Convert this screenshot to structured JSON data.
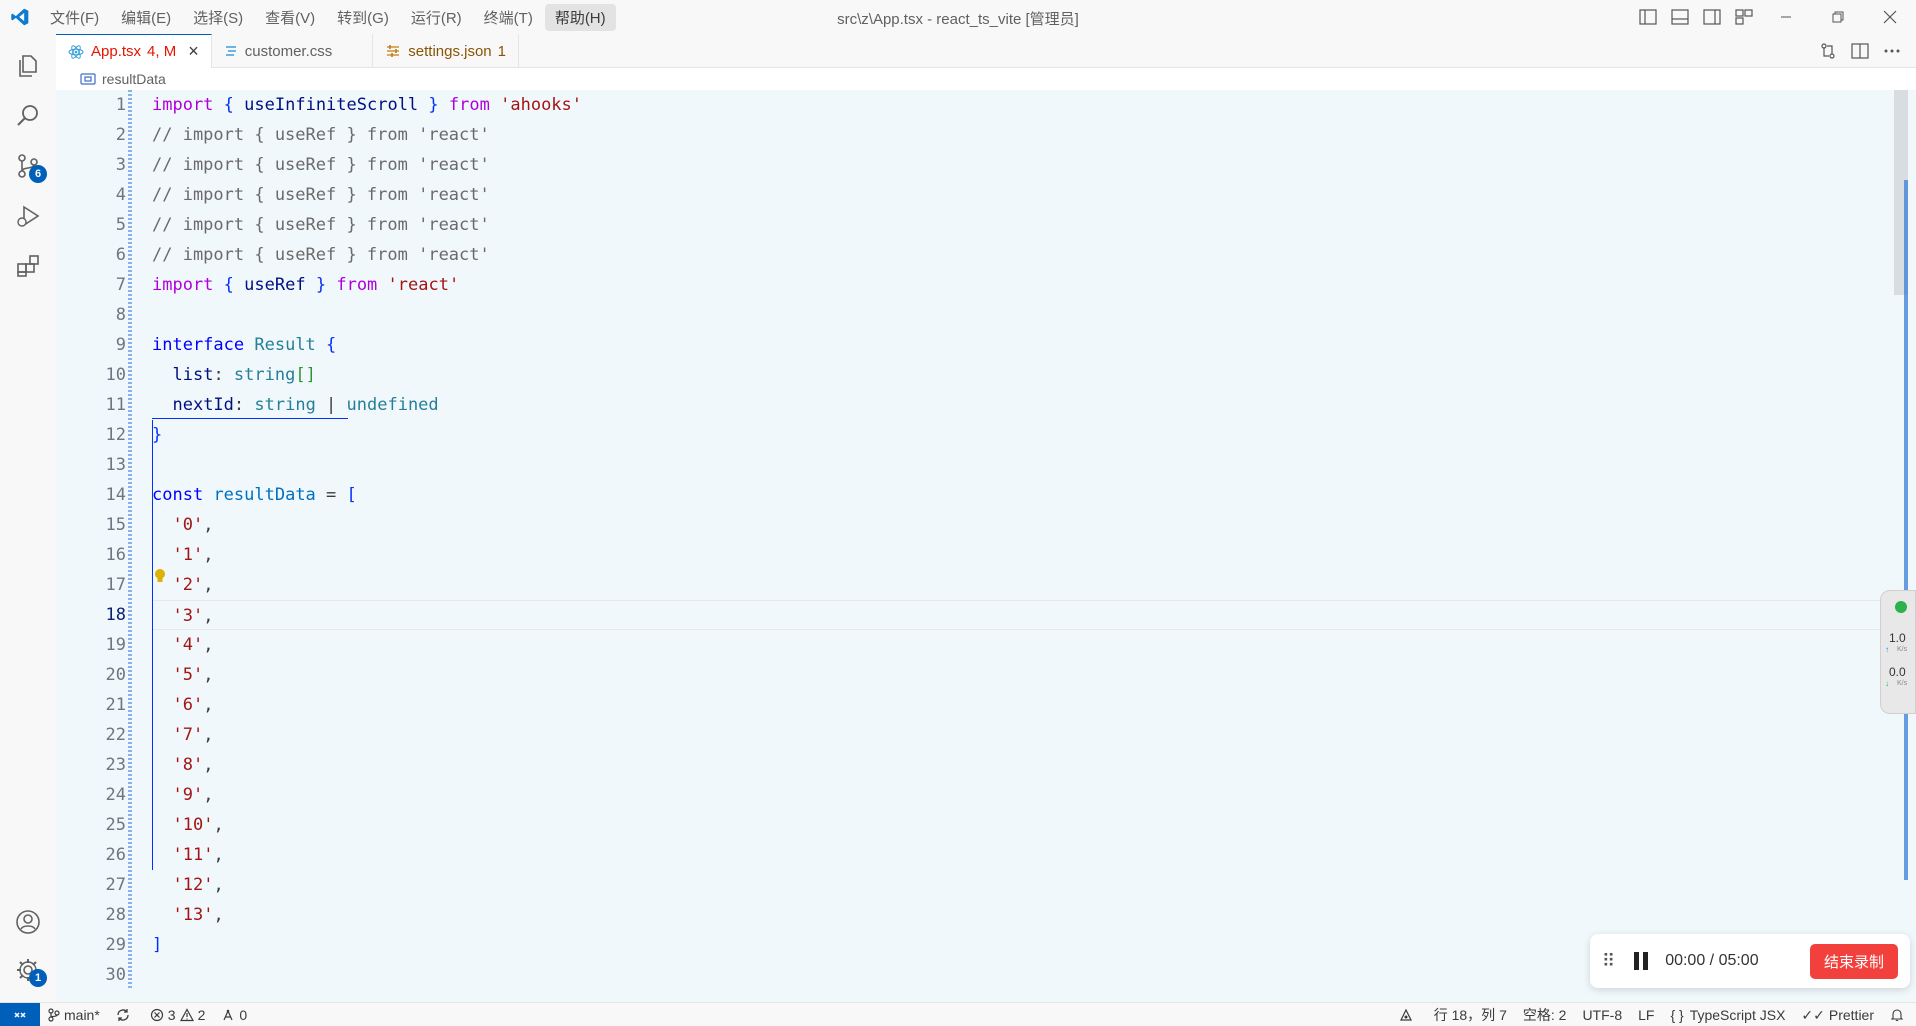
{
  "titlebar": {
    "menus": [
      "文件(F)",
      "编辑(E)",
      "选择(S)",
      "查看(V)",
      "转到(G)",
      "运行(R)",
      "终端(T)",
      "帮助(H)"
    ],
    "title": "src\\z\\App.tsx - react_ts_vite [管理员]"
  },
  "activity": {
    "scm_badge": "6",
    "settings_badge": "1"
  },
  "tabs": [
    {
      "label": "App.tsx",
      "status": "4, M",
      "icon": "react-icon",
      "active": true
    },
    {
      "label": "customer.css",
      "status": "",
      "icon": "css-icon",
      "active": false
    },
    {
      "label": "settings.json",
      "status": "1",
      "icon": "settings-json-icon",
      "active": false
    }
  ],
  "breadcrumb": {
    "symbol": "resultData"
  },
  "editor": {
    "line_numbers": [
      "1",
      "2",
      "3",
      "4",
      "5",
      "6",
      "7",
      "8",
      "9",
      "10",
      "11",
      "12",
      "13",
      "14",
      "15",
      "16",
      "17",
      "18",
      "19",
      "20",
      "21",
      "22",
      "23",
      "24",
      "25",
      "26",
      "27",
      "28",
      "29",
      "30"
    ],
    "current_line": 18,
    "lines": [
      "import { useInfiniteScroll } from 'ahooks'",
      "// import { useRef } from 'react'",
      "// import { useRef } from 'react'",
      "// import { useRef } from 'react'",
      "// import { useRef } from 'react'",
      "// import { useRef } from 'react'",
      "import { useRef } from 'react'",
      "",
      "interface Result {",
      "  list: string[]",
      "  nextId: string | undefined",
      "}",
      "",
      "const resultData = [",
      "  '0',",
      "  '1',",
      "  '2',",
      "  '3',",
      "  '4',",
      "  '5',",
      "  '6',",
      "  '7',",
      "  '8',",
      "  '9',",
      "  '10',",
      "  '11',",
      "  '12',",
      "  '13',",
      "]",
      ""
    ]
  },
  "net_widget": {
    "up": "1.0",
    "down": "0.0",
    "unit": "K/s"
  },
  "recorder": {
    "time": "00:00 / 05:00",
    "stop_label": "结束录制"
  },
  "statusbar": {
    "branch": "main*",
    "errors": "3",
    "warnings": "2",
    "ports": "0",
    "position": "行 18，列 7",
    "spaces": "空格: 2",
    "encoding": "UTF-8",
    "eol": "LF",
    "language": "TypeScript JSX",
    "formatter": "Prettier"
  },
  "colors": {
    "accent": "#005fb8",
    "editor_bg": "#f1f8fc",
    "stop_button": "#f2413c"
  }
}
